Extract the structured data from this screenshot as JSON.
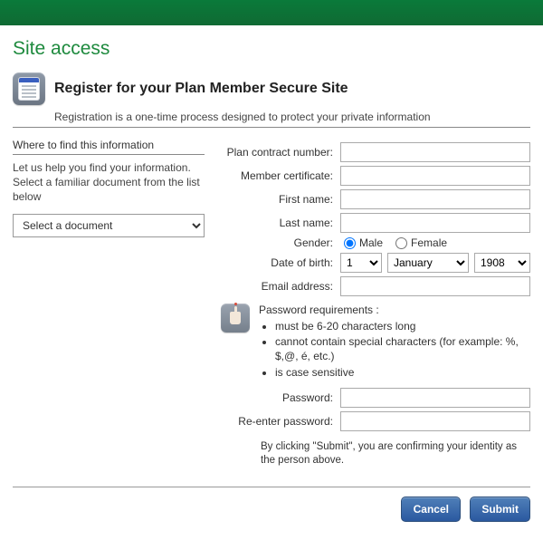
{
  "page": {
    "title": "Site access"
  },
  "header": {
    "title": "Register for your Plan Member Secure Site",
    "subtitle": "Registration is a one-time process designed to protect your private information"
  },
  "info": {
    "heading": "Where to find this information",
    "body": "Let us help you find your information. Select a familiar document from the list below",
    "select_placeholder": "Select a document"
  },
  "form": {
    "labels": {
      "plan": "Plan contract number:",
      "cert": "Member certificate:",
      "first": "First name:",
      "last": "Last name:",
      "gender": "Gender:",
      "dob": "Date of birth:",
      "email": "Email address:",
      "pw": "Password:",
      "pw2": "Re-enter password:"
    },
    "values": {
      "plan": "",
      "cert": "",
      "first": "",
      "last": "",
      "email": "",
      "pw": "",
      "pw2": ""
    },
    "gender": {
      "male": "Male",
      "female": "Female",
      "selected": "male"
    },
    "dob": {
      "day": "1",
      "month": "January",
      "year": "1908"
    }
  },
  "pw_req": {
    "heading": "Password requirements :",
    "items": [
      "must be 6-20 characters long",
      "cannot contain special characters (for example: %, $,@, é, etc.)",
      "is case sensitive"
    ]
  },
  "confirm_text": "By clicking \"Submit\", you are confirming your identity as the person above.",
  "buttons": {
    "cancel": "Cancel",
    "submit": "Submit"
  }
}
